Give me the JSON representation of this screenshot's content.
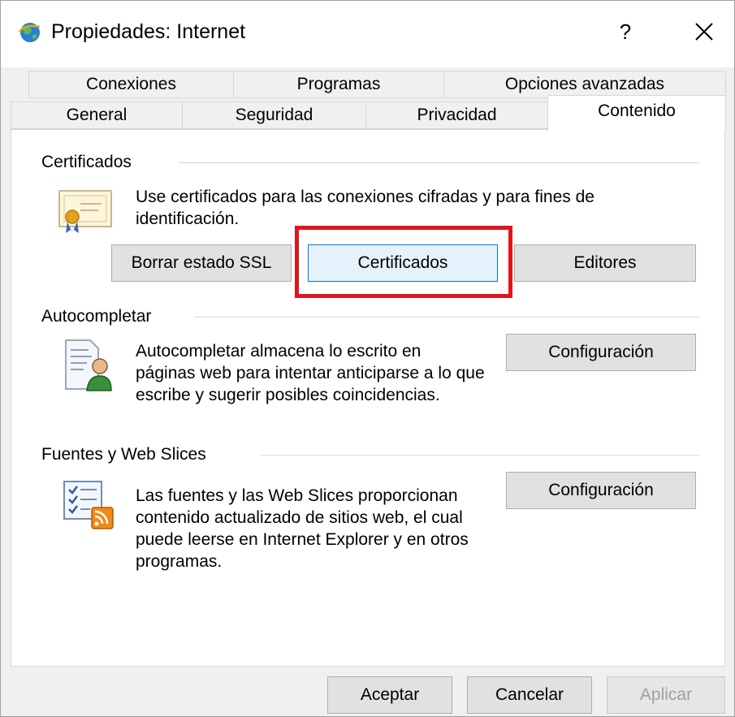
{
  "window": {
    "title": "Propiedades: Internet",
    "help_label": "?",
    "close_label": "✕"
  },
  "tabs": {
    "row1": [
      {
        "label": "Conexiones"
      },
      {
        "label": "Programas"
      },
      {
        "label": "Opciones avanzadas"
      }
    ],
    "row2": [
      {
        "label": "General"
      },
      {
        "label": "Seguridad"
      },
      {
        "label": "Privacidad"
      },
      {
        "label": "Contenido",
        "active": true
      }
    ]
  },
  "certificados": {
    "title": "Certificados",
    "description": "Use certificados para las conexiones cifradas y para fines de identificación.",
    "buttons": {
      "borrar_ssl": "Borrar estado SSL",
      "certificados": "Certificados",
      "editores": "Editores"
    }
  },
  "autocompletar": {
    "title": "Autocompletar",
    "description": "Autocompletar almacena lo escrito en páginas web para intentar anticiparse a lo que escribe y sugerir posibles coincidencias.",
    "button": "Configuración"
  },
  "fuentes": {
    "title": "Fuentes y Web Slices",
    "description": "Las fuentes y las Web Slices proporcionan contenido actualizado de sitios web, el cual puede leerse en Internet Explorer y en otros programas.",
    "button": "Configuración"
  },
  "footer": {
    "aceptar": "Aceptar",
    "cancelar": "Cancelar",
    "aplicar": "Aplicar"
  },
  "colors": {
    "highlight": "#e0151f",
    "focus_border": "#0078d7"
  }
}
